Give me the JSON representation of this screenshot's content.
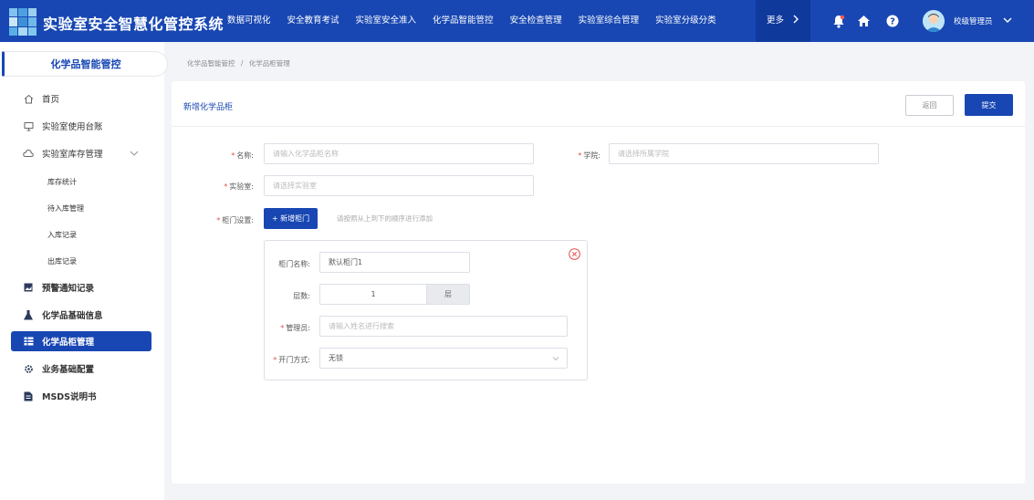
{
  "app": {
    "title": "实验室安全智慧化管控系统"
  },
  "colors": {
    "primary": "#1847b3",
    "required": "#e34c4c"
  },
  "nav": {
    "items": [
      "数据可视化",
      "安全教育考试",
      "实验室安全准入",
      "化学品智能管控",
      "安全检查管理",
      "实验室综合管理",
      "实验室分级分类"
    ],
    "more": "更多"
  },
  "header_icons": [
    "bell-icon",
    "home-icon",
    "help-icon",
    "user-avatar",
    "chevron-down-icon"
  ],
  "user": {
    "name": "校级管理员"
  },
  "sidebar": {
    "title": "化学品智能管控",
    "items": [
      {
        "label": "首页",
        "icon": "home-outline-icon"
      },
      {
        "label": "实验室使用台账",
        "icon": "monitor-icon"
      },
      {
        "label": "实验室库存管理",
        "icon": "cloud-icon"
      },
      {
        "label": "预警通知记录",
        "icon": "image-icon"
      },
      {
        "label": "化学品基础信息",
        "icon": "flask-icon"
      },
      {
        "label": "化学品柜管理",
        "icon": "cabinet-icon"
      },
      {
        "label": "业务基础配置",
        "icon": "gear-icon"
      },
      {
        "label": "MSDS说明书",
        "icon": "document-icon"
      }
    ],
    "subitems": [
      "库存统计",
      "待入库管理",
      "入库记录",
      "出库记录"
    ]
  },
  "breadcrumb": {
    "parent": "化学品智能管控",
    "separator": "/",
    "current": "化学品柜管理"
  },
  "form": {
    "title": "新增化学品柜",
    "back_label": "返回",
    "submit_label": "提交",
    "name_label": "名称:",
    "name_placeholder": "请输入化学品柜名称",
    "college_label": "学院:",
    "college_placeholder": "请选择所属学院",
    "lab_label": "实验室:",
    "lab_placeholder": "请选择实验室",
    "door_label": "柜门设置:",
    "add_door_label": "+ 新增柜门",
    "door_hint": "请按照从上到下的顺序进行添加",
    "door": {
      "name_label": "柜门名称:",
      "name_value": "默认柜门1",
      "layers_label": "层数:",
      "layers_value": "1",
      "layers_unit": "层",
      "manager_label": "管理员:",
      "manager_placeholder": "请输入姓名进行搜索",
      "open_label": "开门方式:",
      "open_value": "无锁"
    }
  }
}
